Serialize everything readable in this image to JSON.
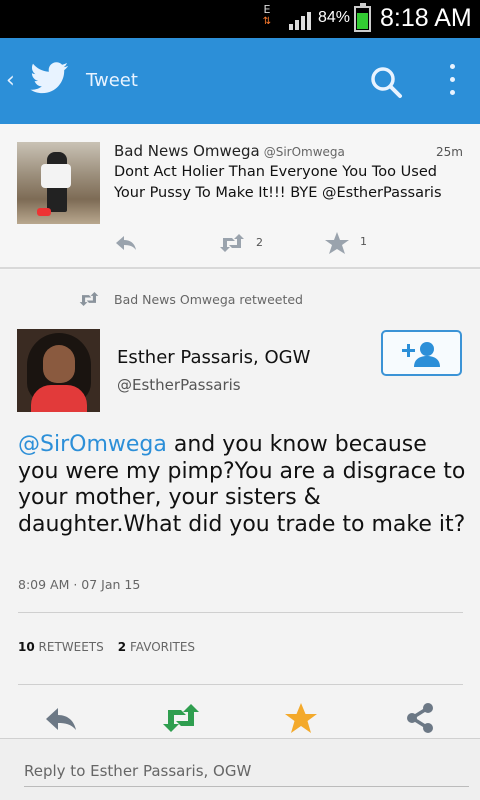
{
  "status_bar": {
    "network": "E",
    "battery_percent": "84%",
    "time": "8:18 AM"
  },
  "app_bar": {
    "title": "Tweet",
    "back_icon": "chevron-left-icon",
    "logo_icon": "twitter-bird-icon",
    "search_icon": "search-icon",
    "more_icon": "overflow-menu-icon",
    "color": "#2c8fd8"
  },
  "parent_tweet": {
    "author_name": "Bad News Omwega",
    "author_handle": "@SirOmwega",
    "time_ago": "25m",
    "text": "Dont Act Holier Than Everyone You Too Used Your Pussy To Make It!!! BYE @EstherPassaris",
    "retweet_count": "2",
    "favorite_count": "1"
  },
  "retweet_note": "Bad News Omwega retweeted",
  "main_tweet": {
    "author_name": "Esther Passaris, OGW",
    "author_handle": "@EstherPassaris",
    "mention": "@SirOmwega",
    "text": " and you know because you were my pimp?You are a disgrace to your mother, your sisters & daughter.What did you trade to make it?",
    "timestamp": "8:09 AM · 07 Jan 15",
    "retweets_count": "10",
    "retweets_label": "RETWEETS",
    "favorites_count": "2",
    "favorites_label": "FAVORITES"
  },
  "actions": {
    "reply_icon": "reply-icon",
    "retweet_icon": "retweet-icon",
    "favorite_icon": "star-icon",
    "share_icon": "share-icon",
    "retweet_color": "#2f9e4f",
    "favorite_color": "#f3a92b"
  },
  "reply_box": {
    "placeholder": "Reply to Esther Passaris, OGW"
  }
}
